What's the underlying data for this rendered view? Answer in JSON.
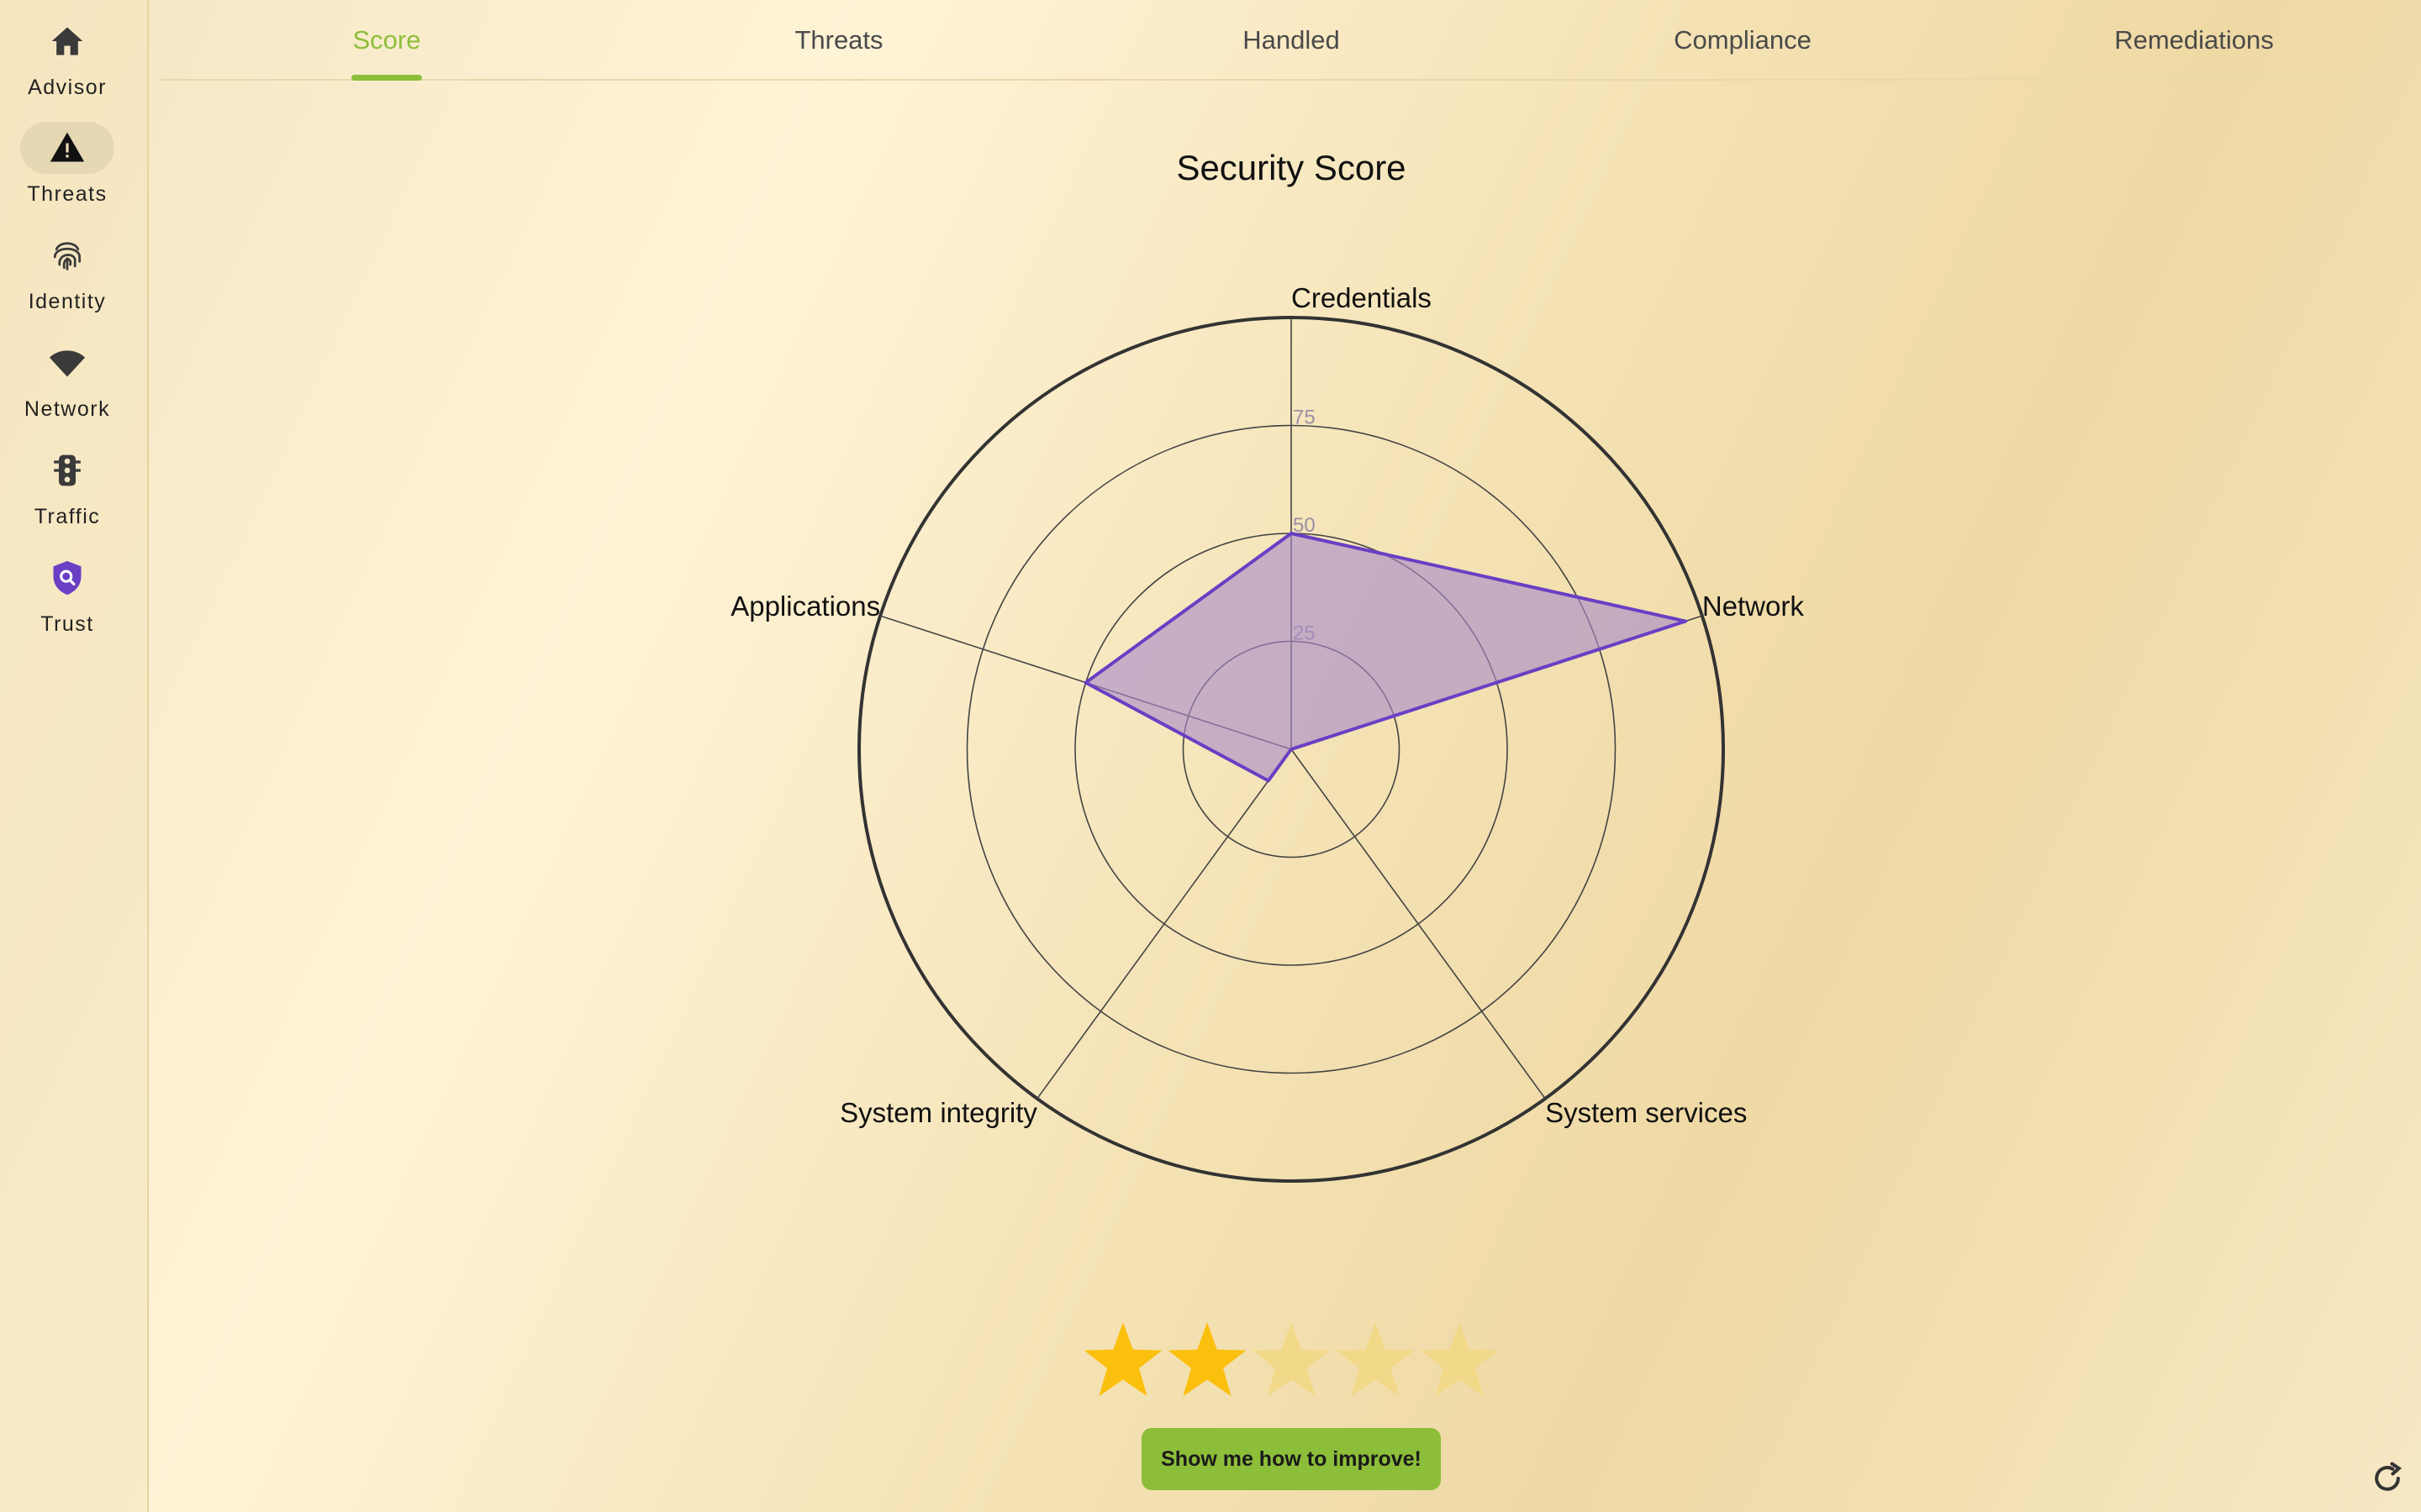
{
  "sidebar": {
    "items": [
      {
        "label": "Advisor",
        "icon": "home-icon"
      },
      {
        "label": "Threats",
        "icon": "warning-icon"
      },
      {
        "label": "Identity",
        "icon": "fingerprint-icon"
      },
      {
        "label": "Network",
        "icon": "wifi-icon"
      },
      {
        "label": "Traffic",
        "icon": "traffic-light-icon"
      },
      {
        "label": "Trust",
        "icon": "shield-search-icon"
      }
    ],
    "active": "Threats"
  },
  "tabs": {
    "items": [
      "Score",
      "Threats",
      "Handled",
      "Compliance",
      "Remediations"
    ],
    "active": "Score"
  },
  "chart_data": {
    "type": "radar",
    "title": "Security Score",
    "axes": [
      "Credentials",
      "Network",
      "System services",
      "System integrity",
      "Applications"
    ],
    "values": [
      50,
      96,
      0,
      9,
      50
    ],
    "rlim": [
      0,
      100
    ],
    "ticks": [
      25,
      50,
      75
    ],
    "colors": {
      "line": "#6a3fc4",
      "fill": "#a98ac9"
    }
  },
  "rating": {
    "value": 2,
    "max": 5
  },
  "actions": {
    "improve_label": "Show me how to improve!"
  },
  "colors": {
    "accent": "#8dbe3a",
    "star_on": "#fbbf0e",
    "star_off": "#f2d98a"
  }
}
